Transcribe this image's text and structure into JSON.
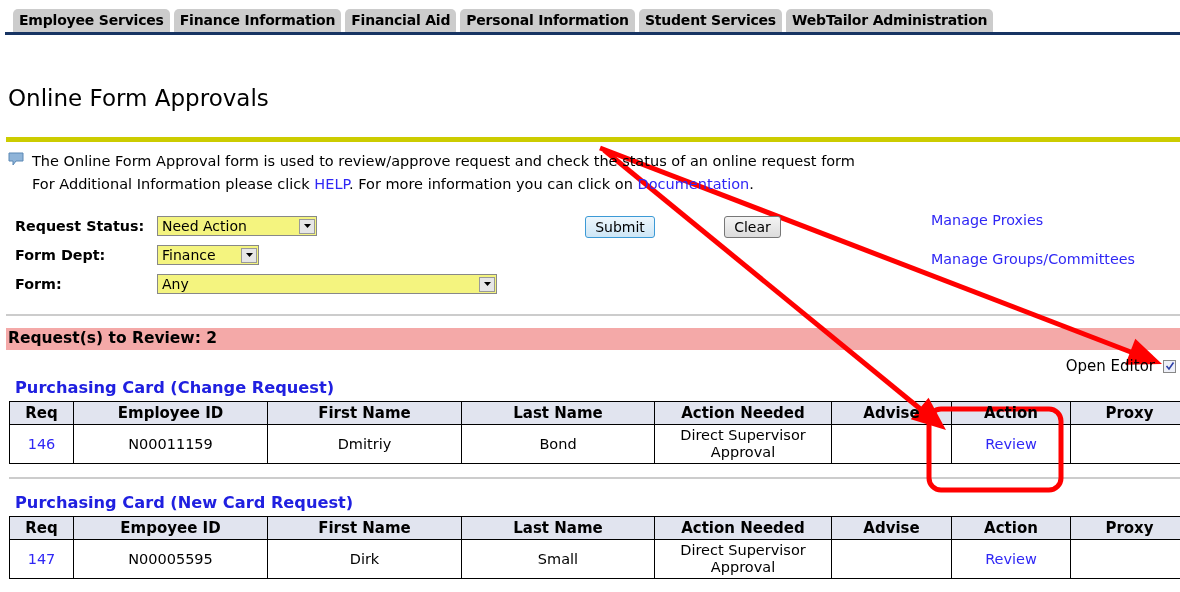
{
  "tabs": [
    "Employee Services",
    "Finance Information",
    "Financial Aid",
    "Personal Information",
    "Student Services",
    "WebTailor Administration"
  ],
  "title": "Online Form Approvals",
  "info": [
    [
      {
        "kind": "text",
        "text": "The Online Form Approval form is used to review/approve request and check the status of an online request form"
      }
    ],
    [
      {
        "kind": "text",
        "text": "For Additional Information please click "
      },
      {
        "kind": "link",
        "text": "HELP"
      },
      {
        "kind": "text",
        "text": ". For more information you can click on "
      },
      {
        "kind": "link",
        "text": "Documentation"
      },
      {
        "kind": "text",
        "text": "."
      }
    ]
  ],
  "filters": [
    {
      "label": "Request Status:",
      "value": "Need Action"
    },
    {
      "label": "Form Dept:",
      "value": "Finance"
    },
    {
      "label": "Form:",
      "value": "Any"
    }
  ],
  "buttons": [
    "Submit",
    "Clear"
  ],
  "links": [
    "Manage Proxies",
    "Manage Groups/Committees"
  ],
  "banner": "Request(s) to Review: 2",
  "open_editor": {
    "label": "Open Editor",
    "checked": true
  },
  "sections": [
    {
      "title": "Purchasing Card (Change Request)",
      "columns": [
        "Req",
        "Employee ID",
        "First Name",
        "Last Name",
        "Action Needed",
        "Advise",
        "Action",
        "Proxy"
      ],
      "rows": [
        [
          {
            "kind": "link",
            "text": "146"
          },
          {
            "kind": "text",
            "text": "N00011159"
          },
          {
            "kind": "text",
            "text": "Dmitriy"
          },
          {
            "kind": "text",
            "text": "Bond"
          },
          {
            "kind": "text",
            "text": "Direct Supervisor Approval"
          },
          null,
          {
            "kind": "link",
            "text": "Review"
          },
          null
        ]
      ]
    },
    {
      "title": "Purchasing Card (New Card Request)",
      "columns": [
        "Req",
        "Empoyee ID",
        "First Name",
        "Last Name",
        "Action Needed",
        "Advise",
        "Action",
        "Proxy"
      ],
      "rows": [
        [
          {
            "kind": "link",
            "text": "147"
          },
          {
            "kind": "text",
            "text": "N00005595"
          },
          {
            "kind": "text",
            "text": "Dirk"
          },
          {
            "kind": "text",
            "text": "Small"
          },
          {
            "kind": "text",
            "text": "Direct Supervisor Approval"
          },
          null,
          {
            "kind": "link",
            "text": "Review"
          },
          null
        ]
      ]
    }
  ],
  "annotations": [
    {
      "kind": "arrow"
    },
    {
      "kind": "arrow"
    },
    {
      "kind": "highlight"
    }
  ]
}
